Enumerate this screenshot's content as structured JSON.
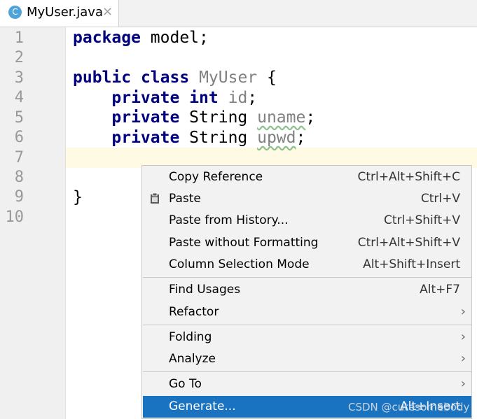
{
  "tab": {
    "icon_letter": "C",
    "title": "MyUser.java",
    "close": "×"
  },
  "line_numbers": [
    "1",
    "2",
    "3",
    "4",
    "5",
    "6",
    "7",
    "8",
    "9",
    "10"
  ],
  "code": {
    "line1_kw": "package",
    "line1_rest": " model;",
    "line3_kw1": "public",
    "line3_kw2": "class",
    "line3_cls": "MyUser",
    "line3_rest": " {",
    "line4_kw1": "private",
    "line4_kw2": "int",
    "line4_fld": "id",
    "line4_end": ";",
    "line5_kw": "private",
    "line5_type": " String ",
    "line5_fld": "uname",
    "line5_end": ";",
    "line6_kw": "private",
    "line6_type": " String ",
    "line6_fld": "upwd",
    "line6_end": ";",
    "line9": "}"
  },
  "menu": {
    "items": [
      {
        "label": "Copy Reference",
        "shortcut": "Ctrl+Alt+Shift+C"
      },
      {
        "label": "Paste",
        "shortcut": "Ctrl+V"
      },
      {
        "label": "Paste from History...",
        "shortcut": "Ctrl+Shift+V"
      },
      {
        "label": "Paste without Formatting",
        "shortcut": "Ctrl+Alt+Shift+V"
      },
      {
        "label": "Column Selection Mode",
        "shortcut": "Alt+Shift+Insert"
      },
      {
        "label": "Find Usages",
        "shortcut": "Alt+F7"
      },
      {
        "label": "Refactor",
        "shortcut": ""
      },
      {
        "label": "Folding",
        "shortcut": ""
      },
      {
        "label": "Analyze",
        "shortcut": ""
      },
      {
        "label": "Go To",
        "shortcut": ""
      },
      {
        "label": "Generate...",
        "shortcut": "Alt+Insert"
      }
    ],
    "submenu_arrow": "›"
  },
  "watermark": "CSDN @cutesomebody",
  "colors": {
    "keyword": "#000080",
    "selection": "#1a73c1",
    "current_line": "#fffae3",
    "gutter": "#f0f0f0"
  }
}
